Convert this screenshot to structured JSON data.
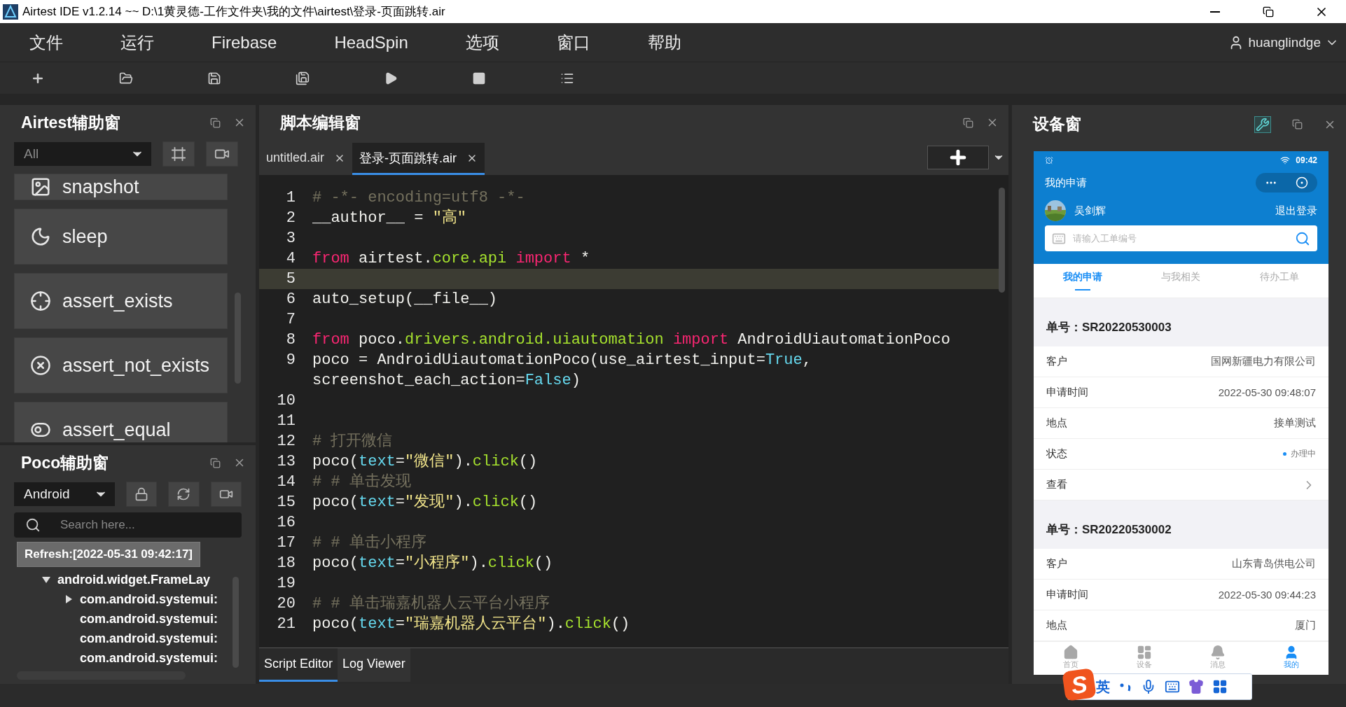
{
  "window": {
    "title": "Airtest IDE v1.2.14 ~~ D:\\1黄灵德-工作文件夹\\我的文件\\airtest\\登录-页面跳转.air"
  },
  "menu": [
    "文件",
    "运行",
    "Firebase",
    "HeadSpin",
    "选项",
    "窗口",
    "帮助"
  ],
  "user": {
    "name": "huanglindge"
  },
  "toolbar": [
    {
      "kind": "new"
    },
    {
      "kind": "open"
    },
    {
      "kind": "save"
    },
    {
      "kind": "save_as"
    },
    {
      "kind": "run"
    },
    {
      "kind": "stop"
    },
    {
      "kind": "log"
    }
  ],
  "airtest_panel": {
    "title": "Airtest辅助窗",
    "filter": "All",
    "actions": [
      {
        "kind": "snapshot",
        "label": "snapshot"
      },
      {
        "kind": "sleep",
        "label": "sleep"
      },
      {
        "kind": "assert_exists",
        "label": "assert_exists"
      },
      {
        "kind": "assert_not_exists",
        "label": "assert_not_exists"
      },
      {
        "kind": "assert_equal",
        "label": "assert_equal"
      }
    ]
  },
  "poco_panel": {
    "title": "Poco辅助窗",
    "platform": "Android",
    "search": {
      "placeholder": "Search here..."
    },
    "refresh": "Refresh:[2022-05-31 09:42:17]",
    "tree": [
      {
        "kind": "branch",
        "label": "android.widget.FrameLay",
        "expanded": true,
        "children": [
          {
            "kind": "branch",
            "label": "com.android.systemui:",
            "expanded": false
          },
          {
            "kind": "leaf",
            "label": "com.android.systemui:"
          },
          {
            "kind": "leaf",
            "label": "com.android.systemui:"
          },
          {
            "kind": "leaf",
            "label": "com.android.systemui:"
          }
        ]
      }
    ]
  },
  "editor": {
    "title": "脚本编辑窗",
    "tabs": [
      {
        "label": "untitled.air",
        "selected": false
      },
      {
        "label": "登录-页面跳转.air",
        "selected": true
      }
    ],
    "lines": [
      {
        "number": "1",
        "current": false,
        "rows": [
          [
            {
              "kind": "comment",
              "text": "# -*- encoding=utf8 -*-"
            }
          ]
        ]
      },
      {
        "number": "2",
        "current": false,
        "rows": [
          [
            {
              "kind": "plain",
              "text": "__author__ = "
            },
            {
              "kind": "string",
              "text": "\"高\""
            }
          ]
        ]
      },
      {
        "number": "3",
        "current": false
      },
      {
        "number": "4",
        "current": false,
        "rows": [
          [
            {
              "kind": "keyword",
              "text": "from"
            },
            {
              "kind": "plain",
              "text": " airtest."
            },
            {
              "kind": "module",
              "text": "core.api"
            },
            {
              "kind": "keyword",
              "text": " import"
            },
            {
              "kind": "plain",
              "text": " *"
            }
          ]
        ]
      },
      {
        "number": "5",
        "current": true
      },
      {
        "number": "6",
        "current": false,
        "rows": [
          [
            {
              "kind": "plain",
              "text": "auto_setup(__file__)"
            }
          ]
        ]
      },
      {
        "number": "7",
        "current": false
      },
      {
        "number": "8",
        "current": false,
        "rows": [
          [
            {
              "kind": "keyword",
              "text": "from"
            },
            {
              "kind": "plain",
              "text": " poco."
            },
            {
              "kind": "module",
              "text": "drivers.android.uiautomation"
            },
            {
              "kind": "keyword",
              "text": " import"
            },
            {
              "kind": "plain",
              "text": " AndroidUiautomationPoco"
            }
          ]
        ]
      },
      {
        "number": "9",
        "current": false,
        "rows": [
          [
            {
              "kind": "plain",
              "text": "poco = AndroidUiautomationPoco(use_airtest_input="
            },
            {
              "kind": "param",
              "text": "True"
            },
            {
              "kind": "plain",
              "text": ", screenshot_each_action="
            },
            {
              "kind": "param",
              "text": "False"
            },
            {
              "kind": "plain",
              "text": ")"
            }
          ]
        ]
      },
      {
        "number": "10",
        "current": false
      },
      {
        "number": "11",
        "current": false
      },
      {
        "number": "12",
        "current": false,
        "rows": [
          [
            {
              "kind": "comment",
              "text": "# 打开微信"
            }
          ]
        ]
      },
      {
        "number": "13",
        "current": false,
        "rows": [
          [
            {
              "kind": "plain",
              "text": "poco("
            },
            {
              "kind": "param",
              "text": "text"
            },
            {
              "kind": "plain",
              "text": "="
            },
            {
              "kind": "string",
              "text": "\"微信\""
            },
            {
              "kind": "plain",
              "text": ")."
            },
            {
              "kind": "module",
              "text": "click"
            },
            {
              "kind": "plain",
              "text": "()"
            }
          ]
        ]
      },
      {
        "number": "14",
        "current": false,
        "rows": [
          [
            {
              "kind": "comment",
              "text": "# # 单击发现"
            }
          ]
        ]
      },
      {
        "number": "15",
        "current": false,
        "rows": [
          [
            {
              "kind": "plain",
              "text": "poco("
            },
            {
              "kind": "param",
              "text": "text"
            },
            {
              "kind": "plain",
              "text": "="
            },
            {
              "kind": "string",
              "text": "\"发现\""
            },
            {
              "kind": "plain",
              "text": ")."
            },
            {
              "kind": "module",
              "text": "click"
            },
            {
              "kind": "plain",
              "text": "()"
            }
          ]
        ]
      },
      {
        "number": "16",
        "current": false
      },
      {
        "number": "17",
        "current": false,
        "rows": [
          [
            {
              "kind": "comment",
              "text": "# # 单击小程序"
            }
          ]
        ]
      },
      {
        "number": "18",
        "current": false,
        "rows": [
          [
            {
              "kind": "plain",
              "text": "poco("
            },
            {
              "kind": "param",
              "text": "text"
            },
            {
              "kind": "plain",
              "text": "="
            },
            {
              "kind": "string",
              "text": "\"小程序\""
            },
            {
              "kind": "plain",
              "text": ")."
            },
            {
              "kind": "module",
              "text": "click"
            },
            {
              "kind": "plain",
              "text": "()"
            }
          ]
        ]
      },
      {
        "number": "19",
        "current": false
      },
      {
        "number": "20",
        "current": false,
        "rows": [
          [
            {
              "kind": "comment",
              "text": "# # 单击瑞嘉机器人云平台小程序"
            }
          ]
        ]
      },
      {
        "number": "21",
        "current": false,
        "rows": [
          [
            {
              "kind": "plain",
              "text": "poco("
            },
            {
              "kind": "param",
              "text": "text"
            },
            {
              "kind": "plain",
              "text": "="
            },
            {
              "kind": "string",
              "text": "\"瑞嘉机器人云平台\""
            },
            {
              "kind": "plain",
              "text": ")."
            },
            {
              "kind": "module",
              "text": "click"
            },
            {
              "kind": "plain",
              "text": "()"
            }
          ]
        ]
      }
    ],
    "bottom_tabs": [
      {
        "label": "Script Editor",
        "selected": true
      },
      {
        "label": "Log Viewer",
        "selected": false
      }
    ]
  },
  "device": {
    "title": "设备窗",
    "phone": {
      "time": "09:42",
      "page_title": "我的申请",
      "user": "吴剑辉",
      "logout": "退出登录",
      "search": {
        "placeholder": "请输入工单编号"
      },
      "tabs": [
        {
          "label": "我的申请",
          "selected": true
        },
        {
          "label": "与我相关",
          "selected": false
        },
        {
          "label": "待办工单",
          "selected": false
        }
      ],
      "orders": [
        {
          "number": "单号：SR20220530003",
          "fields": [
            {
              "kind": "text",
              "label": "客户",
              "value": "国网新疆电力有限公司"
            },
            {
              "kind": "text",
              "label": "申请时间",
              "value": "2022-05-30 09:48:07"
            },
            {
              "kind": "text",
              "label": "地点",
              "value": "接单测试"
            },
            {
              "kind": "status",
              "label": "状态",
              "value": "办理中"
            },
            {
              "kind": "link",
              "label": "查看"
            }
          ]
        },
        {
          "number": "单号：SR20220530002",
          "fields": [
            {
              "kind": "text",
              "label": "客户",
              "value": "山东青岛供电公司"
            },
            {
              "kind": "text",
              "label": "申请时间",
              "value": "2022-05-30 09:44:23"
            },
            {
              "kind": "text",
              "label": "地点",
              "value": "厦门"
            }
          ]
        }
      ],
      "nav": [
        {
          "kind": "home",
          "label": "首页",
          "selected": false
        },
        {
          "kind": "devices",
          "label": "设备",
          "selected": false
        },
        {
          "kind": "messages",
          "label": "消息",
          "selected": false
        },
        {
          "kind": "me",
          "label": "我的",
          "selected": true
        }
      ]
    }
  },
  "ime_bar": {
    "logo": "S",
    "mode": "英"
  }
}
